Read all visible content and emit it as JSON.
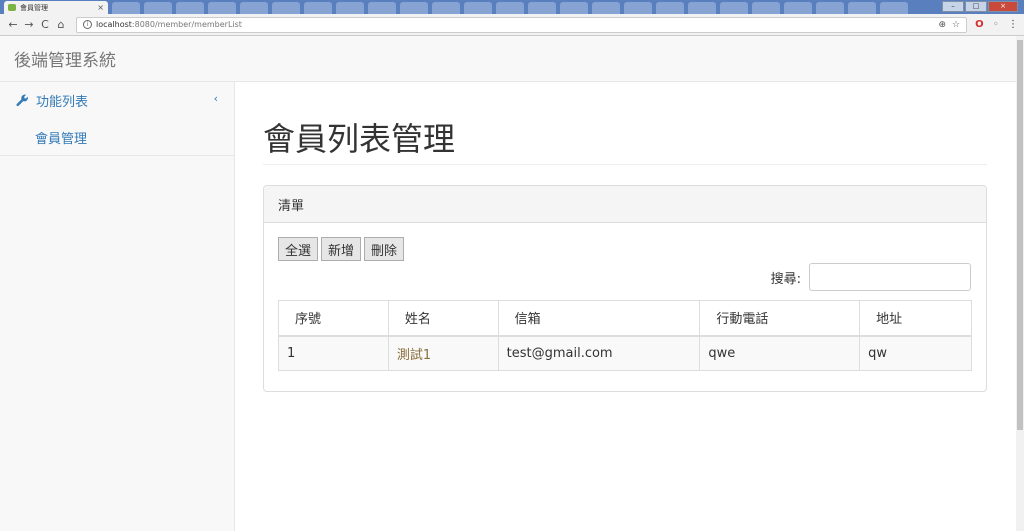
{
  "browser": {
    "tab_title": "會員管理",
    "tab_close": "×",
    "url_host": "localhost",
    "url_rest": ":8080/member/memberList",
    "window_controls": [
      "–",
      "□",
      "×"
    ]
  },
  "navbar": {
    "brand": "後端管理系統"
  },
  "sidebar": {
    "group_label": "功能列表",
    "collapse_glyph": "‹",
    "items": [
      {
        "label": "會員管理"
      }
    ]
  },
  "main": {
    "title": "會員列表管理",
    "panel": {
      "heading": "清單",
      "buttons": {
        "select_all": "全選",
        "add": "新增",
        "delete": "刪除"
      },
      "search": {
        "label": "搜尋:",
        "value": ""
      },
      "table": {
        "columns": [
          "序號",
          "姓名",
          "信箱",
          "行動電話",
          "地址"
        ],
        "rows": [
          {
            "id": "1",
            "name": "測試1",
            "email": "test@gmail.com",
            "phone": "qwe",
            "address": "qw"
          }
        ]
      }
    }
  },
  "colors": {
    "link": "#337ab7",
    "name_cell": "#8a6d3b",
    "tabstrip": "#5a7fbf"
  }
}
